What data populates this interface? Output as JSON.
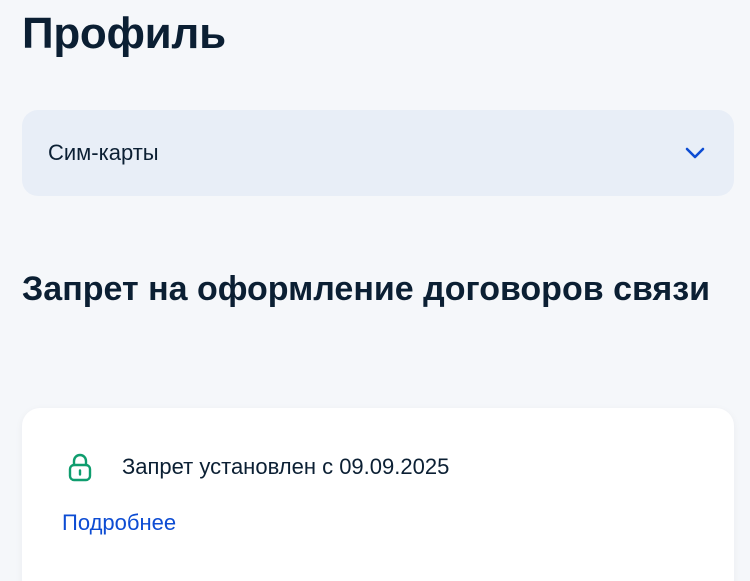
{
  "header": {
    "title": "Профиль"
  },
  "dropdown": {
    "label": "Сим-карты",
    "icon": "chevron-down-icon"
  },
  "section": {
    "title": "Запрет на оформление договоров связи"
  },
  "card": {
    "status_icon": "lock-icon",
    "status_text": "Запрет установлен с 09.09.2025",
    "link_label": "Подробнее"
  },
  "colors": {
    "background": "#f5f7fa",
    "dropdown_bg": "#e8eef7",
    "card_bg": "#ffffff",
    "text": "#0b1f33",
    "link": "#0d4cd3",
    "chevron": "#0d4cd3",
    "lock": "#0f9d6e"
  }
}
